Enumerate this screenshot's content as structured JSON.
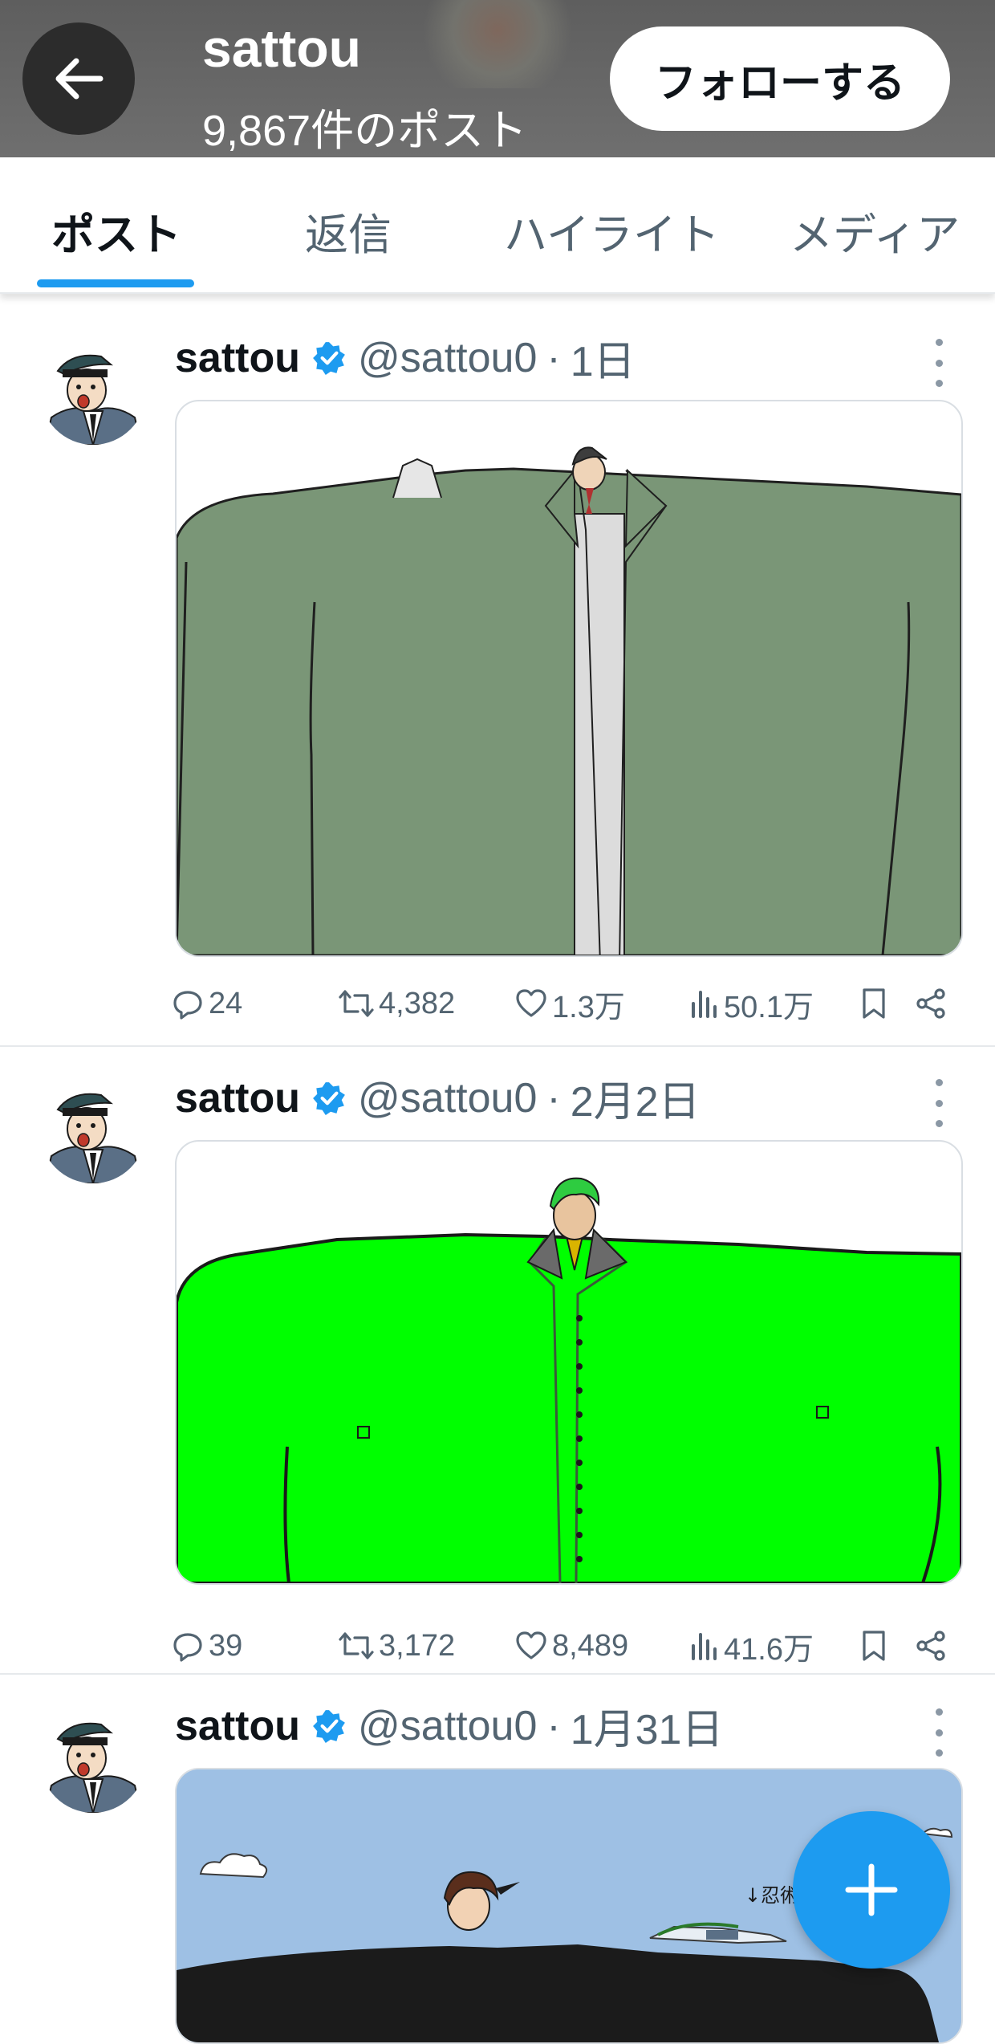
{
  "header": {
    "name": "sattou",
    "post_count": "9,867件のポスト",
    "follow_label": "フォローする"
  },
  "tabs": [
    {
      "label": "ポスト",
      "active": true
    },
    {
      "label": "返信",
      "active": false
    },
    {
      "label": "ハイライト",
      "active": false
    },
    {
      "label": "メディア",
      "active": false
    }
  ],
  "colors": {
    "accent": "#1d9bf0",
    "header_bg": "#666666",
    "text": "#0f1419",
    "secondary": "#536471"
  },
  "posts": [
    {
      "name": "sattou",
      "handle": "@sattou0",
      "dot": "·",
      "date": "1日",
      "media_desc": "green-coat-illustration",
      "replies": "24",
      "reposts": "4,382",
      "likes": "1.3万",
      "views": "50.1万"
    },
    {
      "name": "sattou",
      "handle": "@sattou0",
      "dot": "·",
      "date": "2月2日",
      "media_desc": "bright-green-coat-illustration",
      "replies": "39",
      "reposts": "3,172",
      "likes": "8,489",
      "views": "41.6万"
    },
    {
      "name": "sattou",
      "handle": "@sattou0",
      "dot": "·",
      "date": "1月31日",
      "media_desc": "sky-and-black-body-illustration",
      "image_text": "↓忍術"
    }
  ],
  "icons": {
    "back": "arrow-left-icon",
    "verified": "verified-badge-icon",
    "more": "more-vertical-icon",
    "reply": "reply-icon",
    "repost": "repost-icon",
    "like": "heart-icon",
    "views": "views-icon",
    "bookmark": "bookmark-icon",
    "share": "share-icon",
    "compose": "plus-icon"
  }
}
